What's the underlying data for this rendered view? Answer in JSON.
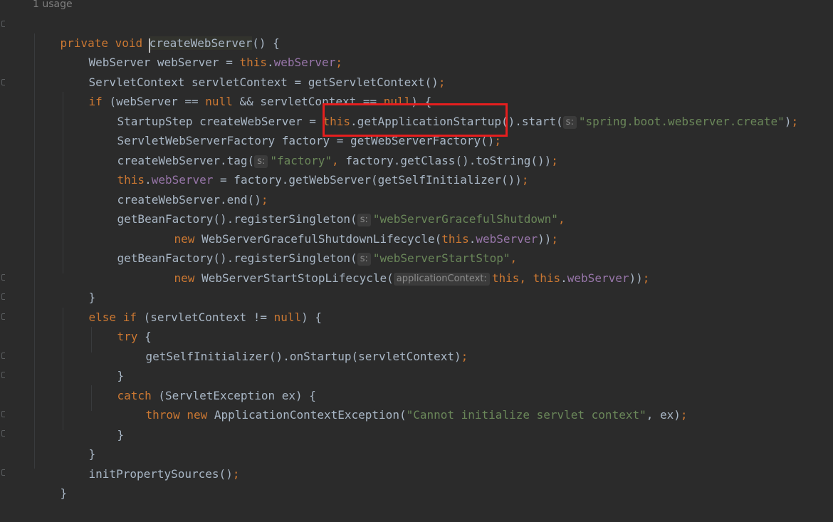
{
  "editor": {
    "usage_hint": "1 usage",
    "hint_labels": {
      "s": "s:",
      "applicationContext": "applicationContext:"
    },
    "lines": {
      "l1": {
        "kw1": "private void ",
        "method": "createWebServer",
        "rest": "() {"
      },
      "l2": {
        "a": "WebServer webServer = ",
        "kw": "this",
        "b": ".",
        "fld": "webServer",
        "c": ";"
      },
      "l3": {
        "a": "ServletContext servletContext = getServletContext()",
        "c": ";"
      },
      "l4": {
        "kw1": "if ",
        "a": "(webServer == ",
        "kw2": "null ",
        "b": "&& servletContext == ",
        "kw3": "null",
        "c": ") {"
      },
      "l5": {
        "a": "StartupStep createWebServer = ",
        "kw": "this",
        "b": ".getApplicationStartup().start(",
        "str": "\"spring.boot.webserver.create\"",
        "c": ")",
        "d": ";"
      },
      "l6": {
        "a": "ServletWebServerFactory factory = getWebServerFactory()",
        "c": ";"
      },
      "l7": {
        "a": "createWebServer.tag(",
        "str": "\"factory\"",
        "b": ", ",
        "c": "factory.getClass().toString())",
        "d": ";"
      },
      "l8": {
        "kw": "this",
        "a": ".",
        "fld": "webServer",
        "b": " = factory.getWebServer(getSelfInitializer())",
        "c": ";"
      },
      "l9": {
        "a": "createWebServer.end()",
        "c": ";"
      },
      "l10": {
        "a": "getBeanFactory().registerSingleton(",
        "str": "\"webServerGracefulShutdown\"",
        "c": ","
      },
      "l11": {
        "kw1": "new ",
        "a": "WebServerGracefulShutdownLifecycle(",
        "kw2": "this",
        "b": ".",
        "fld": "webServer",
        "c": "))",
        "d": ";"
      },
      "l12": {
        "a": "getBeanFactory().registerSingleton(",
        "str": "\"webServerStartStop\"",
        "c": ","
      },
      "l13": {
        "kw1": "new ",
        "a": "WebServerStartStopLifecycle(",
        "kw2": "this",
        "b": ", ",
        "kw3": "this",
        "c": ".",
        "fld": "webServer",
        "d": "))",
        "e": ";"
      },
      "l14": {
        "a": "}"
      },
      "l15": {
        "kw1": "else if ",
        "a": "(servletContext != ",
        "kw2": "null",
        "b": ") {"
      },
      "l16": {
        "kw": "try ",
        "a": "{"
      },
      "l17": {
        "a": "getSelfInitializer().onStartup(servletContext)",
        "c": ";"
      },
      "l18": {
        "a": "}"
      },
      "l19": {
        "kw": "catch ",
        "a": "(ServletException ex) {"
      },
      "l20": {
        "kw1": "throw new ",
        "a": "ApplicationContextException(",
        "str": "\"Cannot initialize servlet context\"",
        "b": ", ex)",
        "c": ";"
      },
      "l21": {
        "a": "}"
      },
      "l22": {
        "a": "}"
      },
      "l23": {
        "a": "initPropertySources()",
        "c": ";"
      },
      "l24": {
        "a": "}"
      }
    }
  },
  "colors": {
    "background": "#2b2b2b",
    "text": "#a9b7c6",
    "keyword": "#cc7832",
    "field": "#9876aa",
    "string": "#6a8759",
    "highlight_border": "#e51e1e"
  }
}
